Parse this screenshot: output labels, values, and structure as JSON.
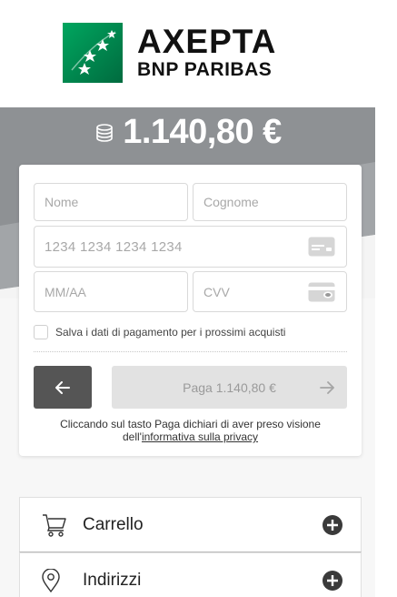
{
  "header": {
    "brand_main": "AXEPTA",
    "brand_sub": "BNP PARIBAS",
    "logo_icon": "bnp-stars-logo",
    "logo_color": "#00915a"
  },
  "payment": {
    "amount": "1.140,80 €",
    "amount_icon": "coins-icon"
  },
  "form": {
    "name_placeholder": "Nome",
    "surname_placeholder": "Cognome",
    "card_placeholder": "1234 1234 1234 1234",
    "expiry_placeholder": "MM/AA",
    "cvv_placeholder": "CVV",
    "save_label": "Salva i dati di pagamento per i prossimi acquisti",
    "save_checked": false
  },
  "actions": {
    "back_icon": "arrow-left-icon",
    "pay_label": "Paga 1.140,80 €",
    "pay_icon": "arrow-right-icon"
  },
  "disclaimer": {
    "text": "Cliccando sul tasto Paga dichiari di aver preso visione",
    "prefix": "dell'",
    "link": "informativa sulla privacy"
  },
  "accordion": [
    {
      "label": "Carrello",
      "icon": "cart-icon"
    },
    {
      "label": "Indirizzi",
      "icon": "location-pin-icon"
    }
  ],
  "colors": {
    "band_dark": "#8f9295",
    "band_light": "#d5d7da",
    "back_button": "#555555",
    "pay_button_disabled": "#e2e2e2"
  }
}
